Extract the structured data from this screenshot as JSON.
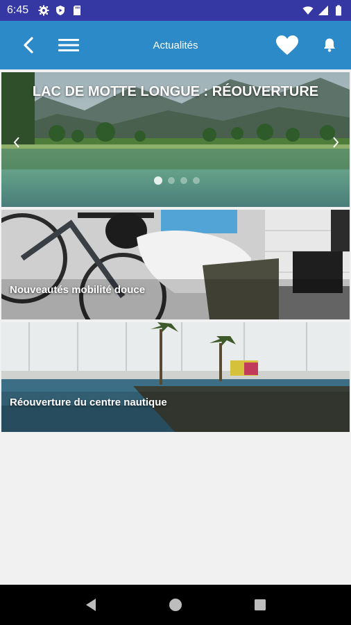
{
  "status_bar": {
    "time": "6:45",
    "left_icons": [
      "gear-icon",
      "shield-icon",
      "sd-card-icon"
    ],
    "right_icons": [
      "wifi-icon",
      "signal-icon",
      "battery-icon"
    ]
  },
  "app_bar": {
    "title": "Actualités",
    "back_icon": "chevron-left-icon",
    "menu_icon": "hamburger-icon",
    "favorite_icon": "heart-icon",
    "notification_icon": "bell-icon",
    "color": "#2d8ac8"
  },
  "carousel": {
    "title": "LAC DE MOTTE LONGUE : RÉOUVERTURE",
    "slide_count": 4,
    "active_index": 0
  },
  "news": [
    {
      "title": "Nouveautés mobilité douce"
    },
    {
      "title": "Réouverture du centre nautique"
    }
  ],
  "colors": {
    "status_bar": "#3538a3",
    "app_bar": "#2d8ac8",
    "background": "#f1f1f1"
  }
}
